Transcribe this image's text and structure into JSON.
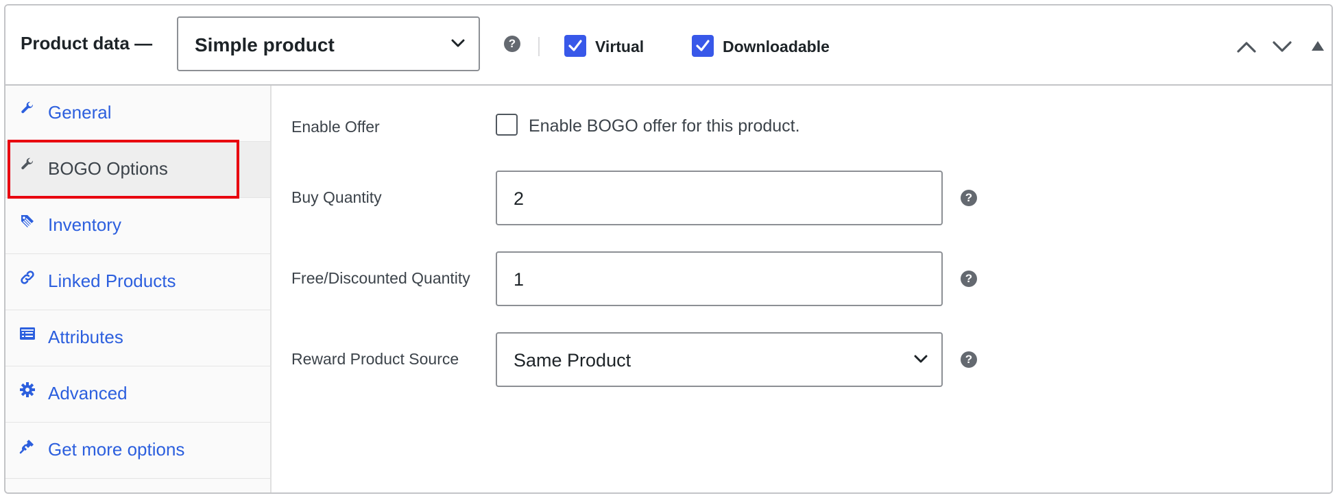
{
  "header": {
    "title": "Product data —",
    "product_type": "Simple product",
    "virtual_label": "Virtual",
    "virtual_checked": true,
    "downloadable_label": "Downloadable",
    "downloadable_checked": true,
    "help_glyph": "?"
  },
  "sidebar": {
    "items": [
      {
        "label": "General",
        "icon": "wrench-icon",
        "active": false
      },
      {
        "label": "BOGO Options",
        "icon": "wrench-icon",
        "active": true
      },
      {
        "label": "Inventory",
        "icon": "tag-icon",
        "active": false
      },
      {
        "label": "Linked Products",
        "icon": "link-icon",
        "active": false
      },
      {
        "label": "Attributes",
        "icon": "list-icon",
        "active": false
      },
      {
        "label": "Advanced",
        "icon": "gear-icon",
        "active": false
      },
      {
        "label": "Get more options",
        "icon": "plug-icon",
        "active": false
      }
    ]
  },
  "bogo": {
    "enable_offer_label": "Enable Offer",
    "enable_offer_text": "Enable BOGO offer for this product.",
    "enable_offer_checked": false,
    "buy_quantity_label": "Buy Quantity",
    "buy_quantity_value": "2",
    "free_quantity_label": "Free/Discounted Quantity",
    "free_quantity_value": "1",
    "reward_source_label": "Reward Product Source",
    "reward_source_value": "Same Product"
  },
  "colors": {
    "link": "#2c5fde",
    "checkbox_checked": "#3858e9",
    "highlight": "#e8000f"
  }
}
